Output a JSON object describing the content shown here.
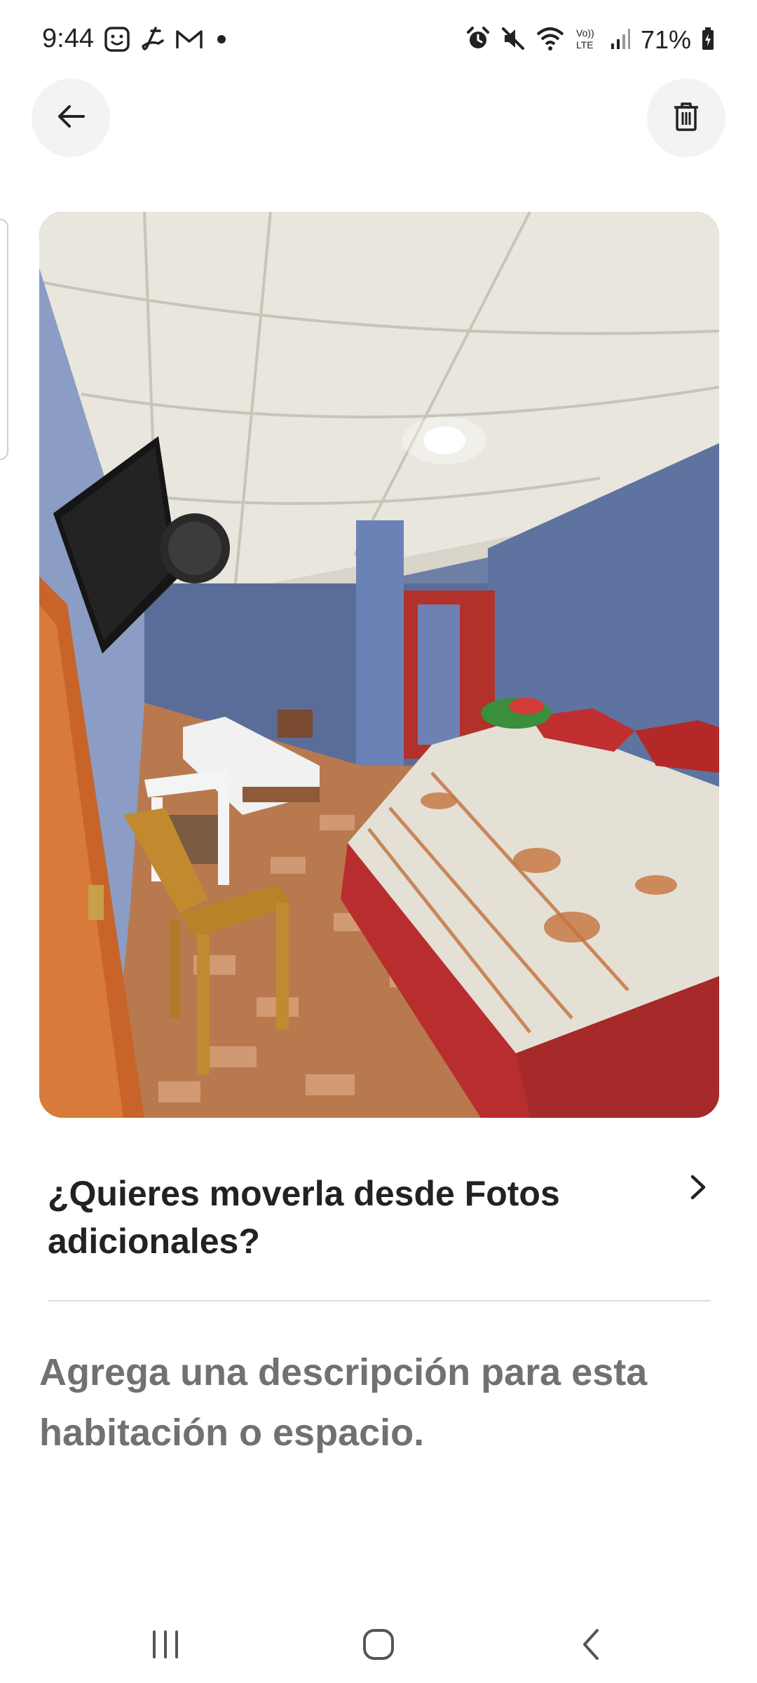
{
  "status_bar": {
    "time": "9:44",
    "left_icons": [
      "smiley-notification-icon",
      "signature-app-icon",
      "gmail-icon",
      "dot-icon"
    ],
    "right_icons": [
      "alarm-icon",
      "mute-icon",
      "wifi-icon",
      "volte-icon",
      "signal-icon"
    ],
    "battery_text": "71%",
    "volte_label": "VoLTE"
  },
  "toolbar": {
    "back_icon": "arrow-left-icon",
    "delete_icon": "trash-icon"
  },
  "photo": {
    "subject": "bedroom"
  },
  "move_prompt": {
    "title": "¿Quieres moverla desde Fotos adicionales?",
    "chevron_icon": "chevron-right-icon"
  },
  "description": {
    "placeholder": "Agrega una descripción para esta habitación o espacio."
  },
  "nav_bar": {
    "recents_icon": "recents-icon",
    "home_icon": "home-icon",
    "back_icon": "back-icon"
  },
  "colors": {
    "text_primary": "#222222",
    "text_secondary": "#717171",
    "button_bg": "#f3f3f3",
    "divider": "#dddddd"
  }
}
